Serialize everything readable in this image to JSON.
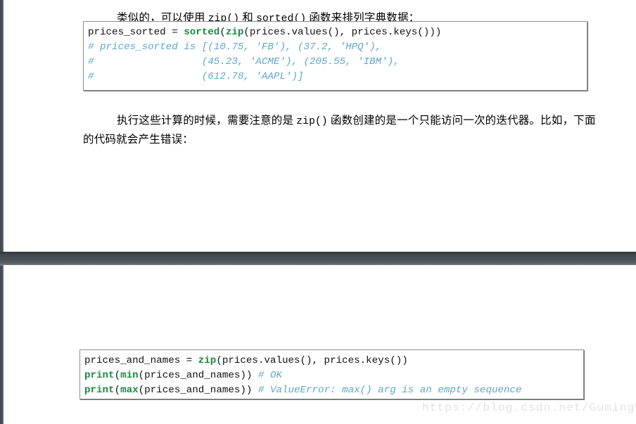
{
  "document": {
    "watermark": "https://blog.csdn.net/GumingW",
    "colors": {
      "keyword_green": "#1a8a3f",
      "comment_blue": "#5fa7c9",
      "page_gap": "#4b5258",
      "code_border": "#8d8d8d",
      "watermark": "#e3e3e3",
      "page_background": "#ffffff",
      "text": "#000000"
    }
  },
  "page_one": {
    "paragraph_intro": {
      "indent": "",
      "part1": "类似的，可以使用 ",
      "code1": "zip()",
      "part2": " 和 ",
      "code2": "sorted()",
      "part3": " 函数来排列字典数据："
    },
    "code_sorted": {
      "line1": {
        "pre": "prices_sorted = ",
        "fn1": "sorted",
        "mid": "(",
        "fn2": "zip",
        "post": "(prices.values(), prices.keys()))"
      },
      "line2": "# prices_sorted is [(10.75, 'FB'), (37.2, 'HPQ'),",
      "line3": "#                  (45.23, 'ACME'), (205.55, 'IBM'),",
      "line4": "#                  (612.78, 'AAPL')]"
    },
    "paragraph_note": {
      "part1": "执行这些计算的时候，需要注意的是 ",
      "code1": "zip()",
      "part2": " 函数创建的是一个只能访问一次的迭代器。比如，下面的代码就会产生错误："
    }
  },
  "page_two": {
    "code_zipiter": {
      "line1": {
        "pre": "prices_and_names = ",
        "fn1": "zip",
        "post": "(prices.values(), prices.keys())"
      },
      "line2": {
        "fn1": "print",
        "mid1": "(",
        "fn2": "min",
        "mid2": "(prices_and_names)) ",
        "comment": "# OK"
      },
      "line3": {
        "fn1": "print",
        "mid1": "(",
        "fn2": "max",
        "mid2": "(prices_and_names)) ",
        "comment": "# ValueError: max() arg is an empty sequence"
      }
    }
  }
}
